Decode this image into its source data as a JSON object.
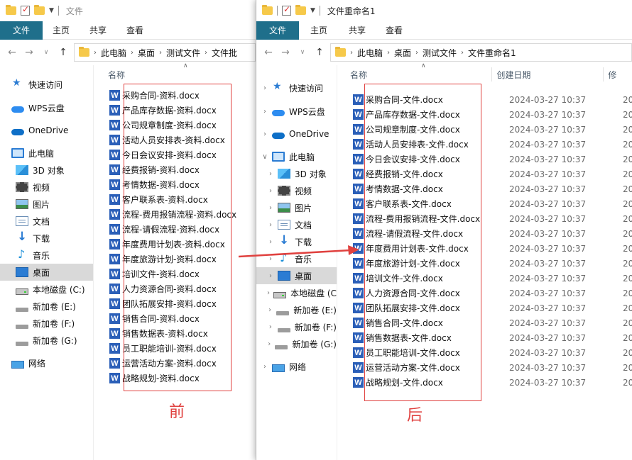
{
  "before": {
    "title": "文件",
    "ribbon_tabs": [
      "文件",
      "主页",
      "共享",
      "查看"
    ],
    "breadcrumb": [
      "此电脑",
      "桌面",
      "测试文件",
      "文件批"
    ],
    "nav": [
      "快速访问",
      "WPS云盘",
      "OneDrive",
      "此电脑",
      "3D 对象",
      "视频",
      "图片",
      "文档",
      "下载",
      "音乐",
      "桌面",
      "本地磁盘 (C:)",
      "新加卷 (E:)",
      "新加卷 (F:)",
      "新加卷 (G:)",
      "网络"
    ],
    "column_name": "名称",
    "files": [
      "采购合同-资料.docx",
      "产品库存数据-资料.docx",
      "公司规章制度-资料.docx",
      "活动人员安排表-资料.docx",
      "今日会议安排-资料.docx",
      "经费报销-资料.docx",
      "考情数据-资料.docx",
      "客户联系表-资料.docx",
      "流程-费用报销流程-资料.docx",
      "流程-请假流程-资料.docx",
      "年度费用计划表-资料.docx",
      "年度旅游计划-资料.docx",
      "培训文件-资料.docx",
      "人力资源合同-资料.docx",
      "团队拓展安排-资料.docx",
      "销售合同-资料.docx",
      "销售数据表-资料.docx",
      "员工职能培训-资料.docx",
      "运营活动方案-资料.docx",
      "战略规划-资料.docx"
    ],
    "caption": "前"
  },
  "after": {
    "title": "文件重命名1",
    "ribbon_tabs": [
      "文件",
      "主页",
      "共享",
      "查看"
    ],
    "breadcrumb": [
      "此电脑",
      "桌面",
      "测试文件",
      "文件重命名1"
    ],
    "nav": [
      "快速访问",
      "WPS云盘",
      "OneDrive",
      "此电脑",
      "3D 对象",
      "视频",
      "图片",
      "文档",
      "下载",
      "音乐",
      "桌面",
      "本地磁盘 (C",
      "新加卷 (E:)",
      "新加卷 (F:)",
      "新加卷 (G:)",
      "网络"
    ],
    "column_name": "名称",
    "column_created": "创建日期",
    "column_modified": "修",
    "files": [
      "采购合同-文件.docx",
      "产品库存数据-文件.docx",
      "公司规章制度-文件.docx",
      "活动人员安排表-文件.docx",
      "今日会议安排-文件.docx",
      "经费报销-文件.docx",
      "考情数据-文件.docx",
      "客户联系表-文件.docx",
      "流程-费用报销流程-文件.docx",
      "流程-请假流程-文件.docx",
      "年度费用计划表-文件.docx",
      "年度旅游计划-文件.docx",
      "培训文件-文件.docx",
      "人力资源合同-文件.docx",
      "团队拓展安排-文件.docx",
      "销售合同-文件.docx",
      "销售数据表-文件.docx",
      "员工职能培训-文件.docx",
      "运营活动方案-文件.docx",
      "战略规划-文件.docx"
    ],
    "created_date": "2024-03-27 10:37",
    "modified_prefix": "20",
    "caption": "后"
  },
  "word_icon_letter": "W",
  "nav_icons": [
    "star-icon",
    "cloud-icon",
    "onedrive-icon",
    "pc-icon",
    "3d-icon",
    "video-icon",
    "picture-icon",
    "document-icon",
    "download-icon",
    "music-icon",
    "desktop-icon",
    "disk-icon",
    "drive-icon",
    "drive-icon",
    "drive-icon",
    "network-icon"
  ],
  "accent": "#1f6f8b",
  "annotation_color": "#e0413f"
}
